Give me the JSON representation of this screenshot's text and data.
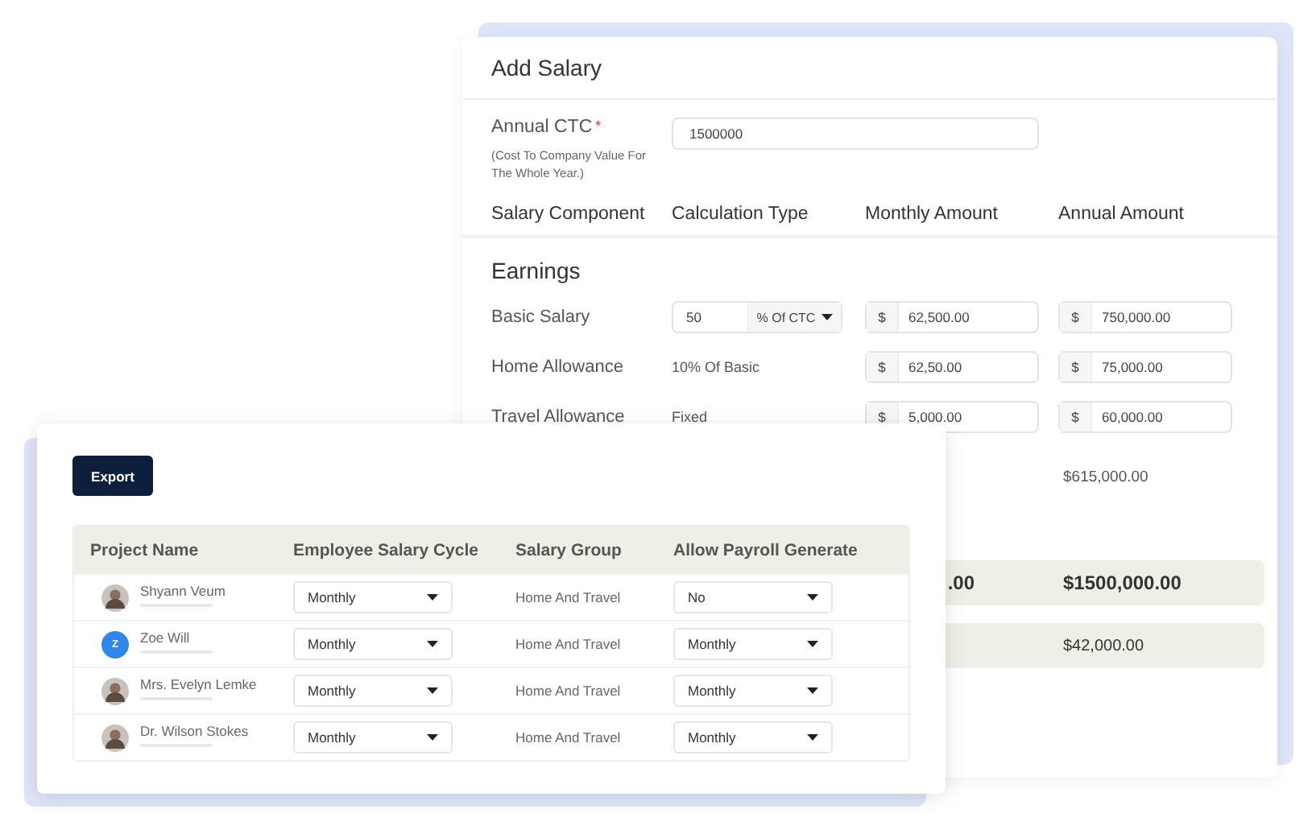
{
  "add_salary": {
    "title": "Add Salary",
    "annual_ctc": {
      "label": "Annual CTC",
      "required_mark": "*",
      "hint": "(Cost To Company Value For The Whole Year.)",
      "value": "1500000"
    },
    "columns": [
      "Salary Component",
      "Calculation Type",
      "Monthly Amount",
      "Annual Amount"
    ],
    "section": "Earnings",
    "rows": [
      {
        "name": "Basic Salary",
        "kind": "percent",
        "calc_value": "50",
        "calc_unit": "% Of CTC",
        "monthly": {
          "currency": "$",
          "value": "62,500.00"
        },
        "annual": {
          "currency": "$",
          "value": "750,000.00"
        }
      },
      {
        "name": "Home Allowance",
        "kind": "text",
        "calc_text": "10% Of Basic",
        "monthly": {
          "currency": "$",
          "value": "62,50.00"
        },
        "annual": {
          "currency": "$",
          "value": "75,000.00"
        }
      },
      {
        "name": "Travel Allowance",
        "kind": "text",
        "calc_text": "Fixed",
        "monthly": {
          "currency": "$",
          "value": "5,000.00"
        },
        "annual": {
          "currency": "$",
          "value": "60,000.00"
        }
      }
    ],
    "subtotal": "$615,000.00",
    "totals": [
      {
        "monthly": ".00",
        "annual": "$1500,000.00",
        "emphasis": true
      },
      {
        "annual": "$42,000.00",
        "emphasis": false
      }
    ]
  },
  "payroll": {
    "export_button": "Export",
    "columns": [
      "Project Name",
      "Employee Salary Cycle",
      "Salary Group",
      "Allow Payroll Generate"
    ],
    "rows": [
      {
        "name": "Shyann Veum",
        "avatar": {
          "kind": "photo"
        },
        "cycle": "Monthly",
        "group": "Home And Travel",
        "payroll": "No"
      },
      {
        "name": "Zoe Will",
        "avatar": {
          "kind": "initial",
          "letter": "Z"
        },
        "cycle": "Monthly",
        "group": "Home And Travel",
        "payroll": "Monthly"
      },
      {
        "name": "Mrs. Evelyn Lemke",
        "avatar": {
          "kind": "photo"
        },
        "cycle": "Monthly",
        "group": "Home And Travel",
        "payroll": "Monthly"
      },
      {
        "name": "Dr. Wilson Stokes",
        "avatar": {
          "kind": "photo"
        },
        "cycle": "Monthly",
        "group": "Home And Travel",
        "payroll": "Monthly"
      }
    ]
  }
}
